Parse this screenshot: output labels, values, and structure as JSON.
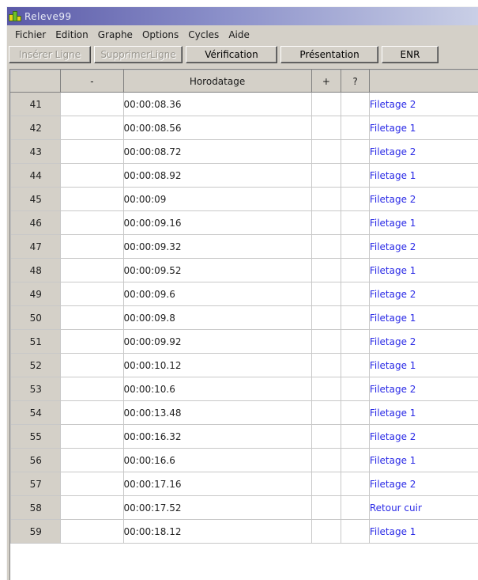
{
  "window": {
    "title": "Releve99"
  },
  "menu": [
    "Fichier",
    "Edition",
    "Graphe",
    "Options",
    "Cycles",
    "Aide"
  ],
  "toolbar": {
    "insert_label": "Insérer Ligne",
    "delete_label": "SupprimerLigne",
    "verify_label": "Vérification",
    "presentation_label": "Présentation",
    "save_label": "ENR"
  },
  "grid": {
    "columns": [
      "",
      "-",
      "Horodatage",
      "+",
      "?",
      ""
    ],
    "rows": [
      {
        "num": "41",
        "ts": "00:00:08.36",
        "action": "Filetage 2"
      },
      {
        "num": "42",
        "ts": "00:00:08.56",
        "action": "Filetage 1"
      },
      {
        "num": "43",
        "ts": "00:00:08.72",
        "action": "Filetage 2"
      },
      {
        "num": "44",
        "ts": "00:00:08.92",
        "action": "Filetage 1"
      },
      {
        "num": "45",
        "ts": "00:00:09",
        "action": "Filetage 2"
      },
      {
        "num": "46",
        "ts": "00:00:09.16",
        "action": "Filetage 1"
      },
      {
        "num": "47",
        "ts": "00:00:09.32",
        "action": "Filetage 2"
      },
      {
        "num": "48",
        "ts": "00:00:09.52",
        "action": "Filetage 1"
      },
      {
        "num": "49",
        "ts": "00:00:09.6",
        "action": "Filetage 2"
      },
      {
        "num": "50",
        "ts": "00:00:09.8",
        "action": "Filetage 1"
      },
      {
        "num": "51",
        "ts": "00:00:09.92",
        "action": "Filetage 2"
      },
      {
        "num": "52",
        "ts": "00:00:10.12",
        "action": "Filetage 1"
      },
      {
        "num": "53",
        "ts": "00:00:10.6",
        "action": "Filetage 2"
      },
      {
        "num": "54",
        "ts": "00:00:13.48",
        "action": "Filetage 1"
      },
      {
        "num": "55",
        "ts": "00:00:16.32",
        "action": "Filetage 2"
      },
      {
        "num": "56",
        "ts": "00:00:16.6",
        "action": "Filetage 1"
      },
      {
        "num": "57",
        "ts": "00:00:17.16",
        "action": "Filetage 2"
      },
      {
        "num": "58",
        "ts": "00:00:17.52",
        "action": "Retour cuir"
      },
      {
        "num": "59",
        "ts": "00:00:18.12",
        "action": "Filetage 1"
      }
    ]
  }
}
